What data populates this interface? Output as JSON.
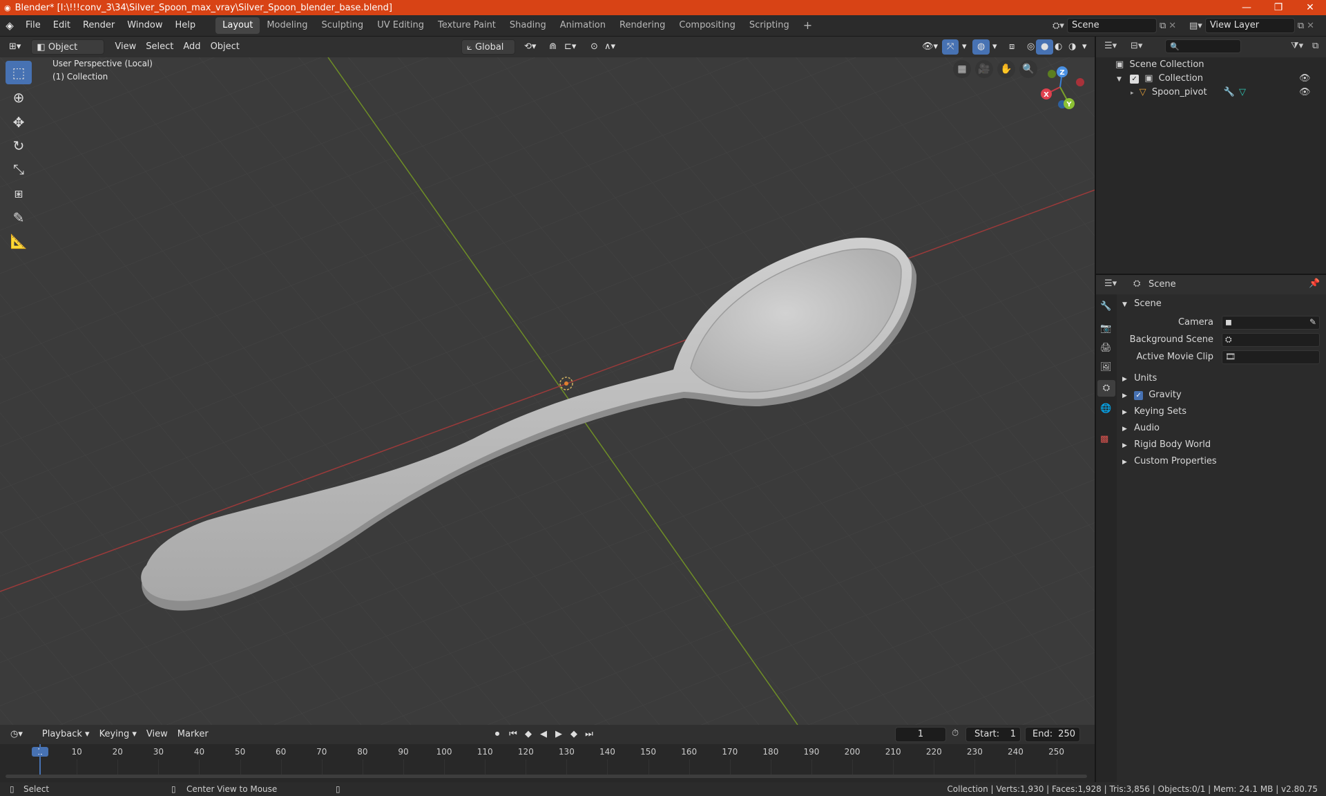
{
  "titlebar": {
    "title": "Blender* [I:\\!!!conv_3\\34\\Silver_Spoon_max_vray\\Silver_Spoon_blender_base.blend]",
    "minimize": "—",
    "maximize": "❐",
    "close": "✕"
  },
  "topbar": {
    "menus": [
      "File",
      "Edit",
      "Render",
      "Window",
      "Help"
    ],
    "workspaces": [
      "Layout",
      "Modeling",
      "Sculpting",
      "UV Editing",
      "Texture Paint",
      "Shading",
      "Animation",
      "Rendering",
      "Compositing",
      "Scripting"
    ],
    "active_workspace": "Layout",
    "add_workspace": "+",
    "scene_name": "Scene",
    "view_layer_name": "View Layer"
  },
  "viewport_header": {
    "mode": "Object Mode",
    "menus": [
      "View",
      "Select",
      "Add",
      "Object"
    ],
    "transform_orientation": "Global"
  },
  "viewport": {
    "perspective_label": "User Perspective (Local)",
    "collection_label": "(1) Collection",
    "gizmo_axes": [
      "X",
      "Y",
      "Z"
    ],
    "axis_colors": {
      "x": "#c43a45",
      "y": "#7ba12a",
      "z": "#3b7fd4"
    }
  },
  "outliner": {
    "scene_collection": "Scene Collection",
    "collection": "Collection",
    "object": "Spoon_pivot"
  },
  "properties": {
    "header_context": "Scene",
    "panel_title": "Scene",
    "camera_label": "Camera",
    "background_scene_label": "Background Scene",
    "active_movie_clip_label": "Active Movie Clip",
    "sections": [
      "Units",
      "Gravity",
      "Keying Sets",
      "Audio",
      "Rigid Body World",
      "Custom Properties"
    ],
    "gravity_checked": true
  },
  "timeline": {
    "menus": [
      "Playback",
      "Keying",
      "View",
      "Marker"
    ],
    "current_frame": "1",
    "start_label": "Start:",
    "start_value": "1",
    "end_label": "End:",
    "end_value": "250",
    "ticks": [
      "1",
      "10",
      "20",
      "30",
      "40",
      "50",
      "60",
      "70",
      "80",
      "90",
      "100",
      "110",
      "120",
      "130",
      "140",
      "150",
      "160",
      "170",
      "180",
      "190",
      "200",
      "210",
      "220",
      "230",
      "240",
      "250"
    ]
  },
  "statusbar": {
    "left_action": "Select",
    "middle_action": "Center View to Mouse",
    "stats": "Collection | Verts:1,930 | Faces:1,928 | Tris:3,856 | Objects:0/1 | Mem: 24.1 MB | v2.80.75"
  }
}
